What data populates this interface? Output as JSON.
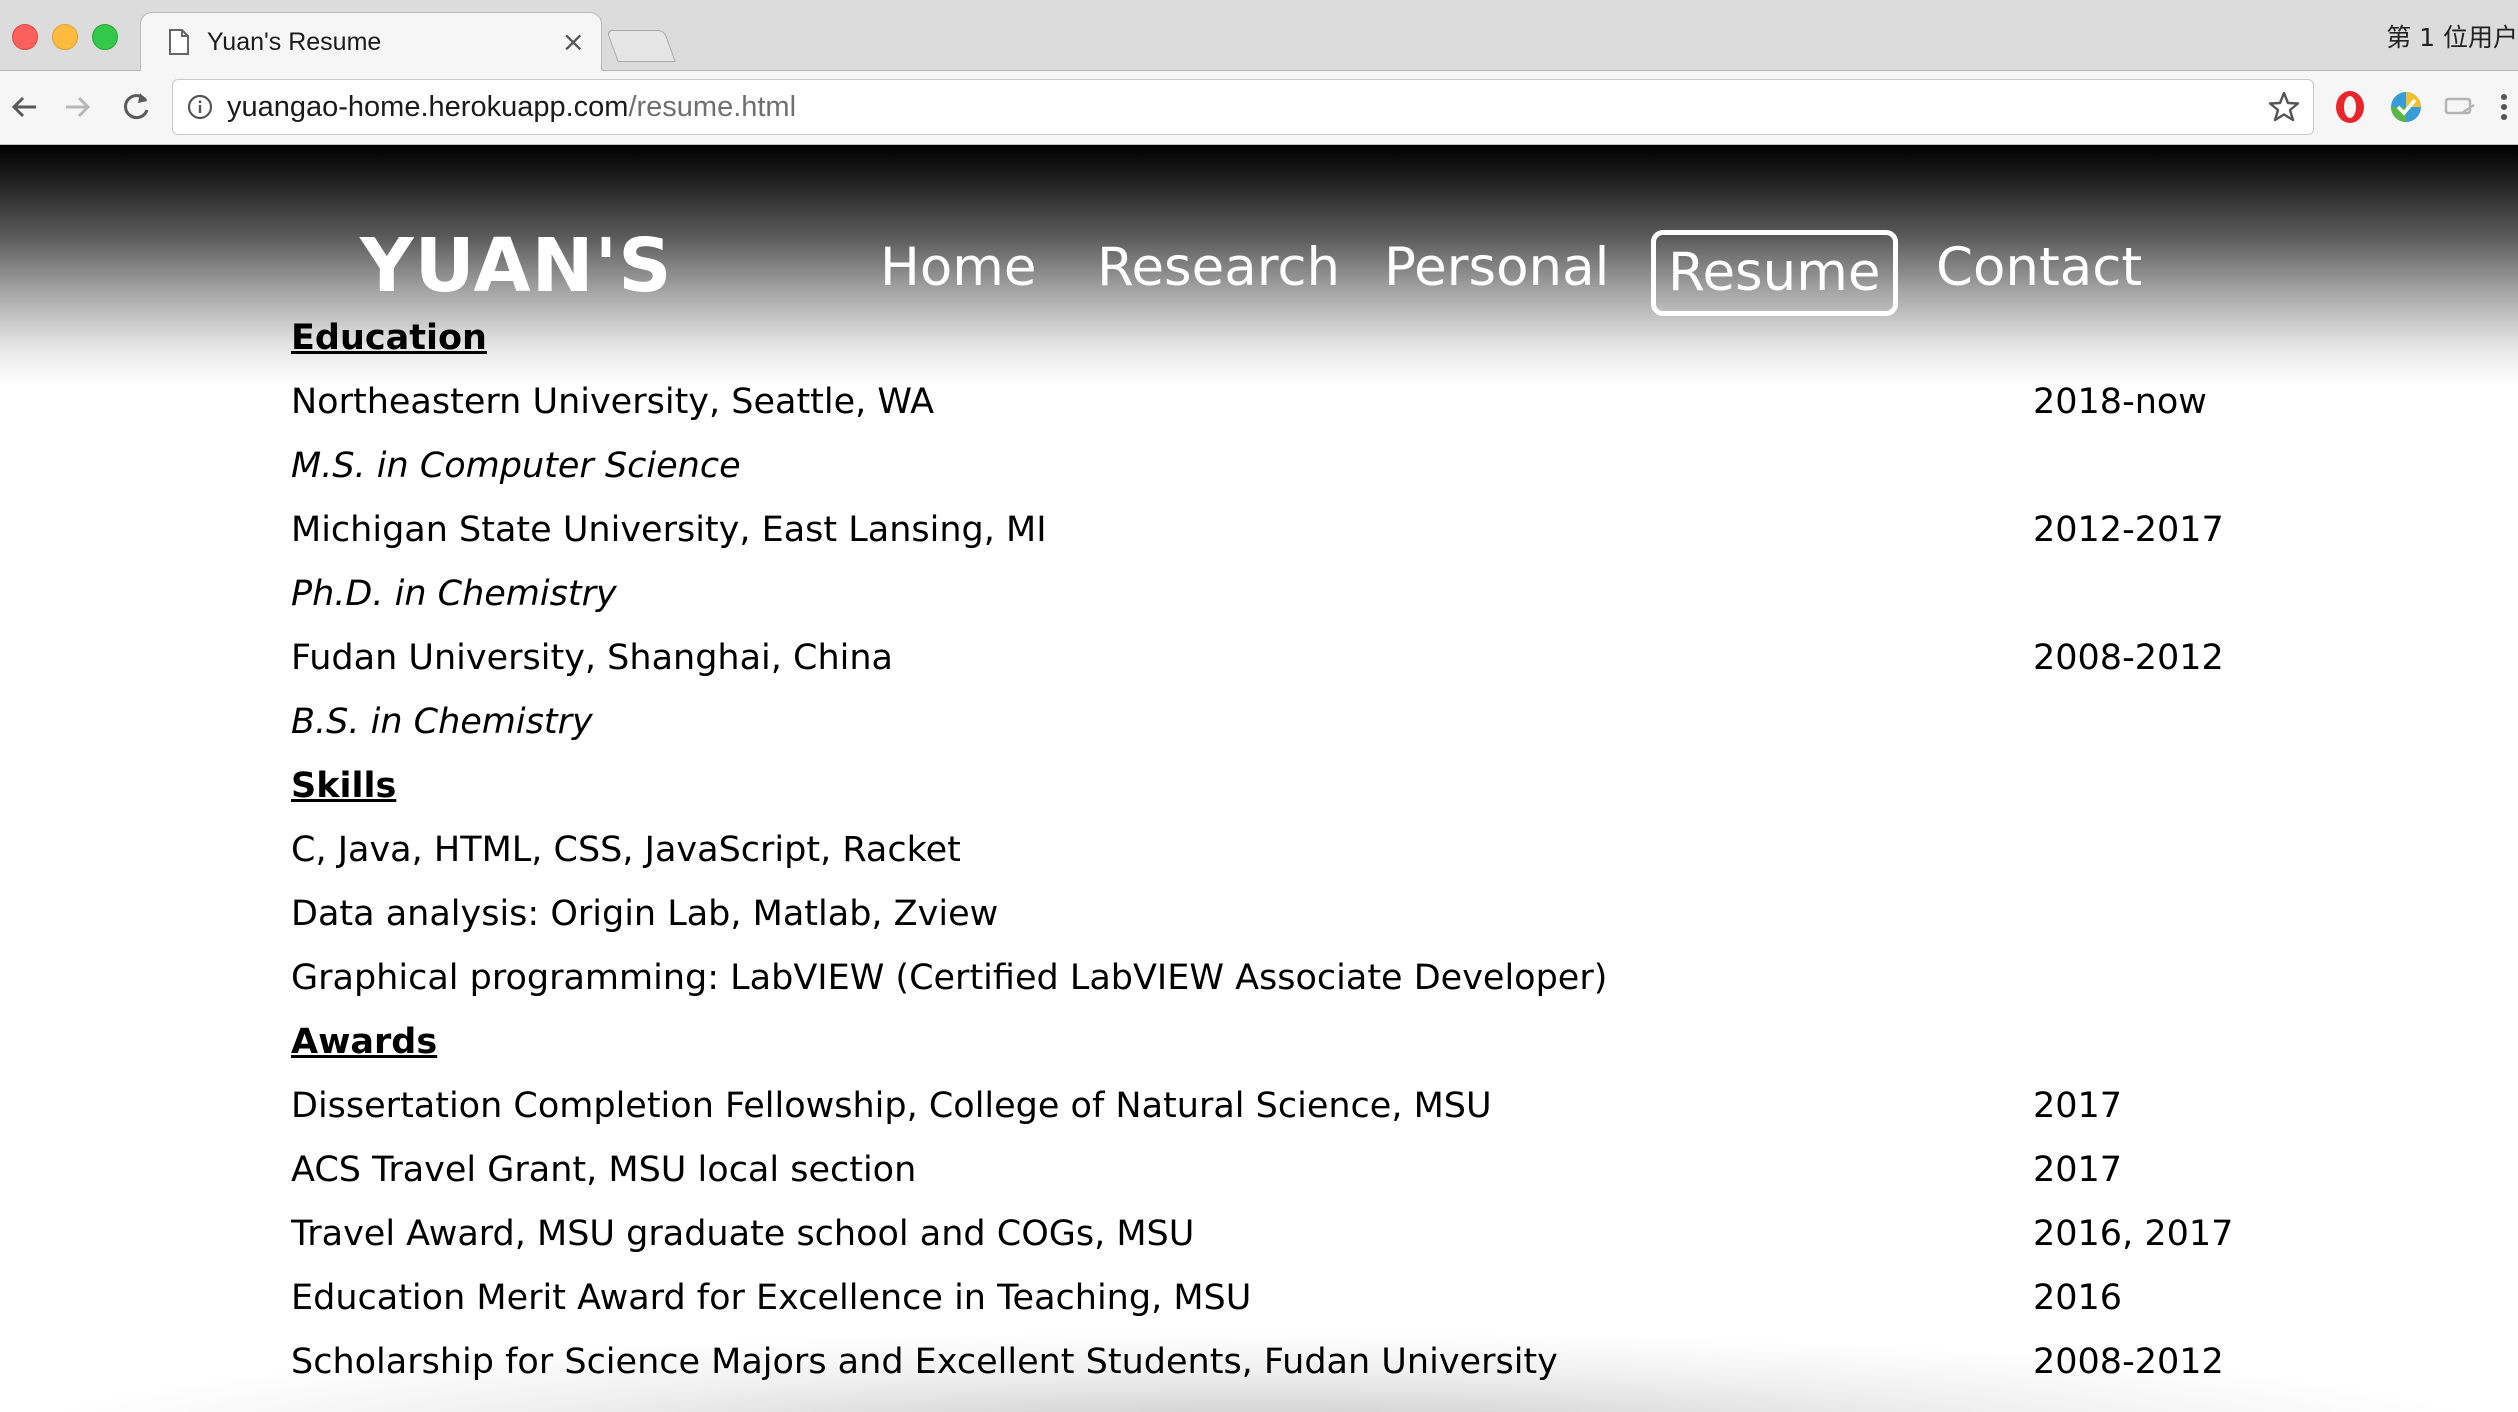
{
  "browser": {
    "tab_title": "Yuan's Resume",
    "tab_close": "×",
    "profile_label": "第 1 位用户",
    "url_host": "yuangao-home.herokuapp.com",
    "url_path": "/resume.html"
  },
  "site": {
    "logo": "YUAN'S",
    "nav": [
      "Home",
      "Research",
      "Personal",
      "Resume",
      "Contact"
    ],
    "active_nav": "Resume"
  },
  "resume": {
    "education": {
      "heading": "Education",
      "entries": [
        {
          "school": "Northeastern University, Seattle, WA",
          "years": "2018-now",
          "degree": "M.S. in Computer Science"
        },
        {
          "school": "Michigan State University, East Lansing, MI",
          "years": "2012-2017",
          "degree": "Ph.D. in Chemistry"
        },
        {
          "school": "Fudan University, Shanghai, China",
          "years": "2008-2012",
          "degree": "B.S. in Chemistry"
        }
      ]
    },
    "skills": {
      "heading": "Skills",
      "items": [
        "C, Java, HTML, CSS, JavaScript, Racket",
        "Data analysis: Origin Lab, Matlab, Zview",
        "Graphical programming: LabVIEW (Certified LabVIEW Associate Developer)"
      ]
    },
    "awards": {
      "heading": "Awards",
      "items": [
        {
          "name": "Dissertation Completion Fellowship, College of Natural Science, MSU",
          "year": "2017"
        },
        {
          "name": "ACS Travel Grant, MSU local section",
          "year": "2017"
        },
        {
          "name": "Travel Award, MSU graduate school and COGs, MSU",
          "year": "2016, 2017"
        },
        {
          "name": "Education Merit Award for Excellence in Teaching, MSU",
          "year": "2016"
        },
        {
          "name": "Scholarship for Science Majors and Excellent Students, Fudan University",
          "year": "2008-2012"
        }
      ]
    }
  },
  "colors": {
    "traffic_close": "#fc605c",
    "traffic_min": "#fdbc40",
    "traffic_max": "#34c84a",
    "opera_red": "#e8252b"
  }
}
